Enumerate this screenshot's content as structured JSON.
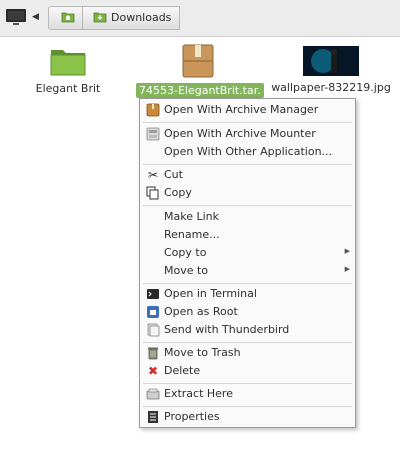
{
  "breadcrumb": {
    "current_folder": "Downloads"
  },
  "files": [
    {
      "name": "Elegant Brit",
      "kind": "folder",
      "selected": false
    },
    {
      "name": "74553-ElegantBrit.tar.",
      "kind": "archive",
      "selected": true
    },
    {
      "name": "wallpaper-832219.jpg",
      "kind": "image",
      "selected": false
    }
  ],
  "context_menu": {
    "items": [
      {
        "label": "Open With Archive Manager",
        "icon": "archive-manager-icon"
      },
      {
        "label": "Open With Archive Mounter",
        "icon": "archive-mounter-icon"
      },
      {
        "label": "Open With Other Application...",
        "icon": ""
      },
      {
        "label": "Cut",
        "icon": "scissors-icon"
      },
      {
        "label": "Copy",
        "icon": "copy-icon"
      },
      {
        "label": "Make Link",
        "icon": ""
      },
      {
        "label": "Rename...",
        "icon": ""
      },
      {
        "label": "Copy to",
        "icon": "",
        "submenu": true
      },
      {
        "label": "Move to",
        "icon": "",
        "submenu": true
      },
      {
        "label": "Open in Terminal",
        "icon": "terminal-icon"
      },
      {
        "label": "Open as Root",
        "icon": "root-icon"
      },
      {
        "label": "Send with Thunderbird",
        "icon": "thunderbird-icon"
      },
      {
        "label": "Move to Trash",
        "icon": "trash-icon"
      },
      {
        "label": "Delete",
        "icon": "delete-icon"
      },
      {
        "label": "Extract Here",
        "icon": "extract-icon"
      },
      {
        "label": "Properties",
        "icon": "properties-icon"
      }
    ]
  },
  "colors": {
    "selection": "#83b55a",
    "folder_green": "#7cb342",
    "delete_red": "#d32f2f"
  }
}
